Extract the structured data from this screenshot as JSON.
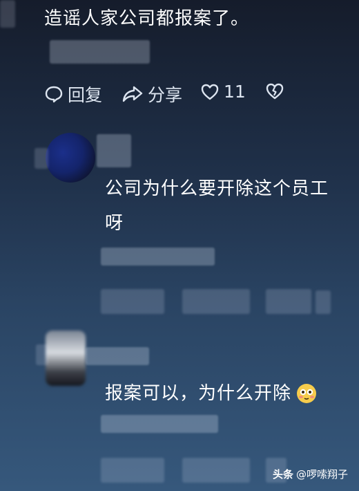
{
  "comment1": {
    "text": "造谣人家公司都报案了。",
    "actions": {
      "reply_label": "回复",
      "share_label": "分享",
      "like_count": "11"
    }
  },
  "reply1": {
    "text_line1": "公司为什么要开除这个员工",
    "text_line2": "呀"
  },
  "reply2": {
    "text": "报案可以，为什么开除",
    "emoji": "😳"
  },
  "watermark": {
    "brand": "头条",
    "author": "@啰嗦翔子"
  }
}
